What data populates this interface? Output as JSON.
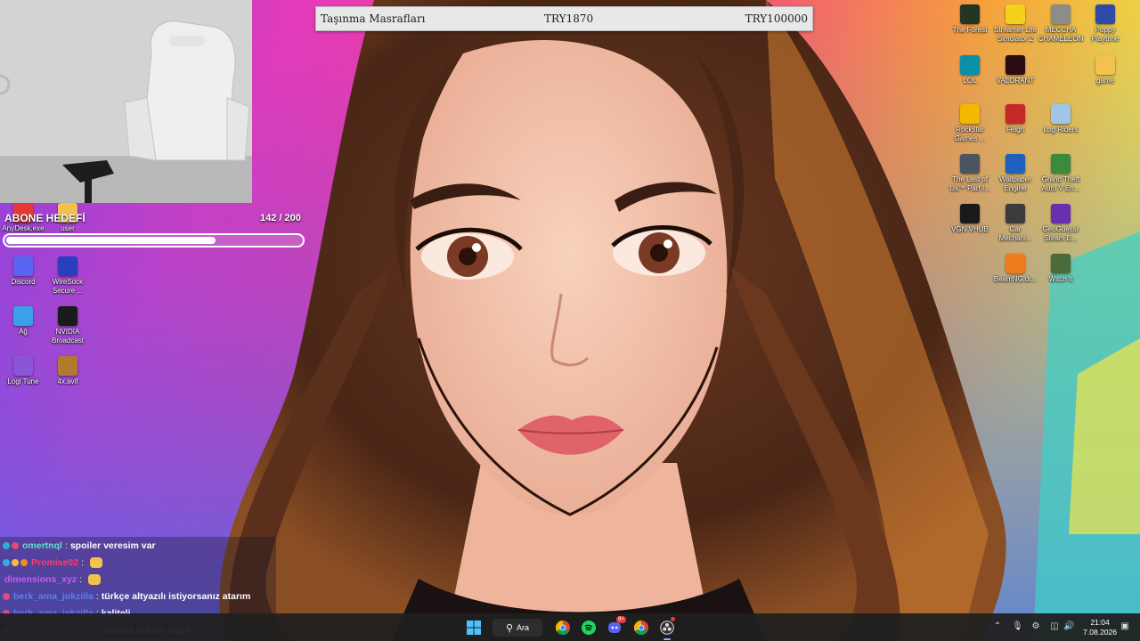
{
  "donation_banner": {
    "title": "Taşınma Masrafları",
    "current": "TRY1870",
    "goal": "TRY100000"
  },
  "sub_goal": {
    "title": "ABONE HEDEFİ",
    "count": "142 / 200",
    "progress": 0.71
  },
  "desktop_left": [
    {
      "label": "AnyDesk.exe",
      "icon": "anydesk-icon",
      "color": "#e53935"
    },
    {
      "label": "user",
      "icon": "folder-icon",
      "color": "#f2c14e"
    },
    {
      "label": "Discord",
      "icon": "discord-icon",
      "color": "#5865f2"
    },
    {
      "label": "WireSock Secure ...",
      "icon": "wiresock-icon",
      "color": "#2a3fbf"
    },
    {
      "label": "Ağ",
      "icon": "network-icon",
      "color": "#3aa0e8"
    },
    {
      "label": "NVIDIA Broadcast",
      "icon": "nvidia-icon",
      "color": "#1b1b1b"
    },
    {
      "label": "Logi Tune",
      "icon": "logitune-icon",
      "color": "#8a55d6"
    },
    {
      "label": "4x.avif",
      "icon": "image-file-icon",
      "color": "#b07a30"
    }
  ],
  "desktop_right": [
    {
      "label": "The Forest",
      "icon": "the-forest-icon",
      "color": "#243523"
    },
    {
      "label": "Streamer Life Simulator 2",
      "icon": "streamer-life-icon",
      "color": "#f2d21a"
    },
    {
      "label": "MECCHA CHAMELEON",
      "icon": "meccha-chameleon-icon",
      "color": "#8c8c8c"
    },
    {
      "label": "Poppy Playtime",
      "icon": "poppy-playtime-icon",
      "color": "#2e4aa8"
    },
    {
      "label": "LOL",
      "icon": "lol-icon",
      "color": "#0a8fa8"
    },
    {
      "label": "VALORANT",
      "icon": "valorant-icon",
      "color": "#2b0c10"
    },
    {
      "label": "game",
      "icon": "folder-icon",
      "color": "#f2c14e"
    },
    {
      "label": "Rockstar Games ...",
      "icon": "rockstar-icon",
      "color": "#f5b800"
    },
    {
      "label": "Feign",
      "icon": "feign-icon",
      "color": "#c62828"
    },
    {
      "label": "Log Riders",
      "icon": "log-riders-icon",
      "color": "#9fc6e8"
    },
    {
      "label": "The Last of Us™ Part I...",
      "icon": "the-last-of-us-icon",
      "color": "#4a5560"
    },
    {
      "label": "Wallpaper Engine",
      "icon": "wallpaper-engine-icon",
      "color": "#1f5fbf"
    },
    {
      "label": "Grand Theft Auto V En...",
      "icon": "gta-v-icon",
      "color": "#3c8a3c"
    },
    {
      "label": "VGN VHUB",
      "icon": "vgn-vhub-icon",
      "color": "#1a1a1a"
    },
    {
      "label": "Car Mechani...",
      "icon": "car-mechanic-icon",
      "color": "#3b3b3b"
    },
    {
      "label": "GeoGuessr Steam E...",
      "icon": "geoguessr-icon",
      "color": "#6a2fb0"
    },
    {
      "label": "BeamNG.dr...",
      "icon": "beamng-icon",
      "color": "#f07c1e"
    },
    {
      "label": "Witch It",
      "icon": "witch-it-icon",
      "color": "#4b6b3b"
    }
  ],
  "chat": [
    {
      "user": "omertnql",
      "user_color": "#5ee0d2",
      "message": "spoiler veresim var",
      "emote": false,
      "badges": [
        "#2bb4c8",
        "#e04a7a"
      ]
    },
    {
      "user": "Promise02",
      "user_color": "#ff3b6b",
      "message": "",
      "emote": true,
      "badges": [
        "#3ba7e8",
        "#f0c040",
        "#f08a1e"
      ]
    },
    {
      "user": "dimensions_xyz",
      "user_color": "#c55cf2",
      "message": "",
      "emote": true,
      "badges": []
    },
    {
      "user": "berk_ama_jokzilla",
      "user_color": "#5d7ee8",
      "message": "türkçe altyazılı istiyorsanız atarım",
      "emote": false,
      "badges": [
        "#e04a7a"
      ]
    },
    {
      "user": "berk_ama_jokzilla",
      "user_color": "#5d7ee8",
      "message": "kaliteli",
      "emote": false,
      "badges": [
        "#e04a7a"
      ]
    },
    {
      "user": "berk_ama_jokzilla",
      "user_color": "#5d7ee8",
      "message": "sinema çekimi değil",
      "emote": false,
      "badges": [
        "#e04a7a"
      ]
    }
  ],
  "taskbar": {
    "start_icon": "windows-start-icon",
    "search_label": "Ara",
    "apps": [
      "chrome-icon",
      "spotify-icon",
      "discord-icon",
      "chrome-icon",
      "obs-icon"
    ],
    "discord_badge": "9+",
    "tray": [
      "chevron-up-icon",
      "microphone-icon",
      "vpn-icon",
      "network-icon",
      "volume-icon"
    ],
    "time": "21:04",
    "date": "7.08.2026"
  }
}
